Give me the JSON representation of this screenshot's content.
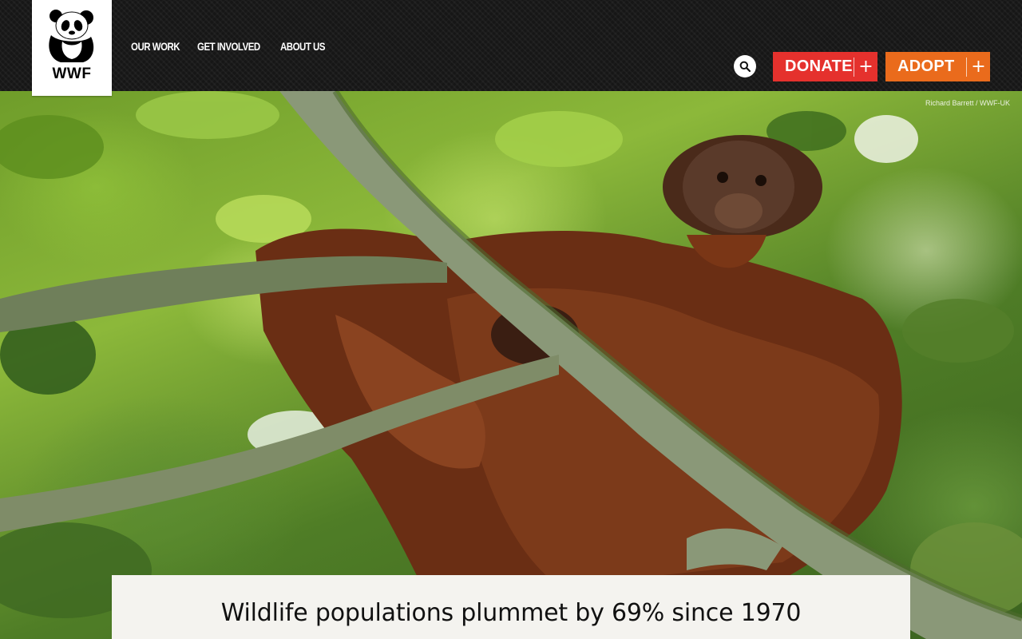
{
  "brand": {
    "logo_text": "WWF"
  },
  "nav": {
    "items": [
      {
        "label": "OUR WORK"
      },
      {
        "label": "GET INVOLVED"
      },
      {
        "label": "ABOUT US"
      }
    ]
  },
  "header": {
    "donate_label": "DONATE",
    "adopt_label": "ADOPT",
    "plus_glyph": "+",
    "icons": {
      "search": "search-icon",
      "logo": "panda-logo-icon"
    }
  },
  "hero": {
    "photo_credit": "Richard Barrett / WWF-UK",
    "headline": "Wildlife populations plummet by 69% since 1970"
  },
  "colors": {
    "donate": "#e5312d",
    "adopt": "#ea6b1c",
    "header_bg": "#161616",
    "headline_box": "#f4f3ef"
  }
}
